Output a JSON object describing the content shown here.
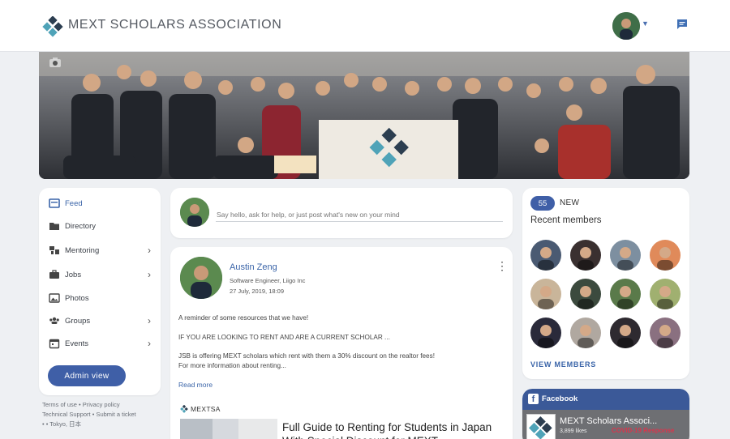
{
  "brand": {
    "name": "MEXT SCHOLARS ASSOCIATION"
  },
  "colors": {
    "accent": "#3f5fa7",
    "link": "#3a64a8",
    "logo_dark": "#2c3e50",
    "logo_teal": "#4fa3b8",
    "facebook": "#3b5998"
  },
  "header": {
    "avatar_icon": "user-avatar",
    "menu_icon": "chevron-down-icon",
    "messages_icon": "chat-icon"
  },
  "banner": {
    "camera_icon": "camera-icon"
  },
  "nav": {
    "items": [
      {
        "label": "Feed",
        "icon": "feed-icon",
        "active": true,
        "submenu": false
      },
      {
        "label": "Directory",
        "icon": "folder-icon",
        "active": false,
        "submenu": false
      },
      {
        "label": "Mentoring",
        "icon": "mentoring-icon",
        "active": false,
        "submenu": true
      },
      {
        "label": "Jobs",
        "icon": "briefcase-icon",
        "active": false,
        "submenu": true
      },
      {
        "label": "Photos",
        "icon": "photo-icon",
        "active": false,
        "submenu": false
      },
      {
        "label": "Groups",
        "icon": "groups-icon",
        "active": false,
        "submenu": true
      },
      {
        "label": "Events",
        "icon": "calendar-icon",
        "active": false,
        "submenu": true
      }
    ],
    "admin_button": "Admin view"
  },
  "footer": {
    "terms": "Terms of use",
    "privacy": "Privacy policy",
    "support": "Technical Support",
    "ticket": "Submit a ticket",
    "location": "Tokyo, 日本"
  },
  "composer": {
    "placeholder": "Say hello, ask for help, or just post what's new on your mind"
  },
  "post": {
    "author": "Austin Zeng",
    "job": "Software Engineer, Liigo Inc",
    "date": "27 July, 2019, 18:09",
    "body": [
      "A reminder of some resources that we have!",
      "",
      "IF YOU ARE LOOKING TO RENT AND ARE A CURRENT SCHOLAR ...",
      "",
      "JSB is offering MEXT scholars which rent with them a 30% discount on the realtor fees!",
      "For more information about renting..."
    ],
    "read_more": "Read more",
    "source": "MEXTSA",
    "link_title": "Full Guide to Renting for Students in Japan With Special Discount for MEXT"
  },
  "members": {
    "new_count": "55",
    "new_label": "NEW",
    "title": "Recent members",
    "view_all": "VIEW MEMBERS",
    "avatar_colors": [
      "#4a5a72",
      "#3a3030",
      "#7d8fa0",
      "#e08a5a",
      "#c9b59a",
      "#3c4a3e",
      "#5a7a4a",
      "#a0b070",
      "#2a2a3a",
      "#b0a8a0",
      "#2e2a30",
      "#8a7080"
    ]
  },
  "facebook": {
    "title": "Facebook",
    "page_name": "MEXT Scholars Associ...",
    "likes": "3,899 likes",
    "banner_text": "COVID-19 Response"
  }
}
